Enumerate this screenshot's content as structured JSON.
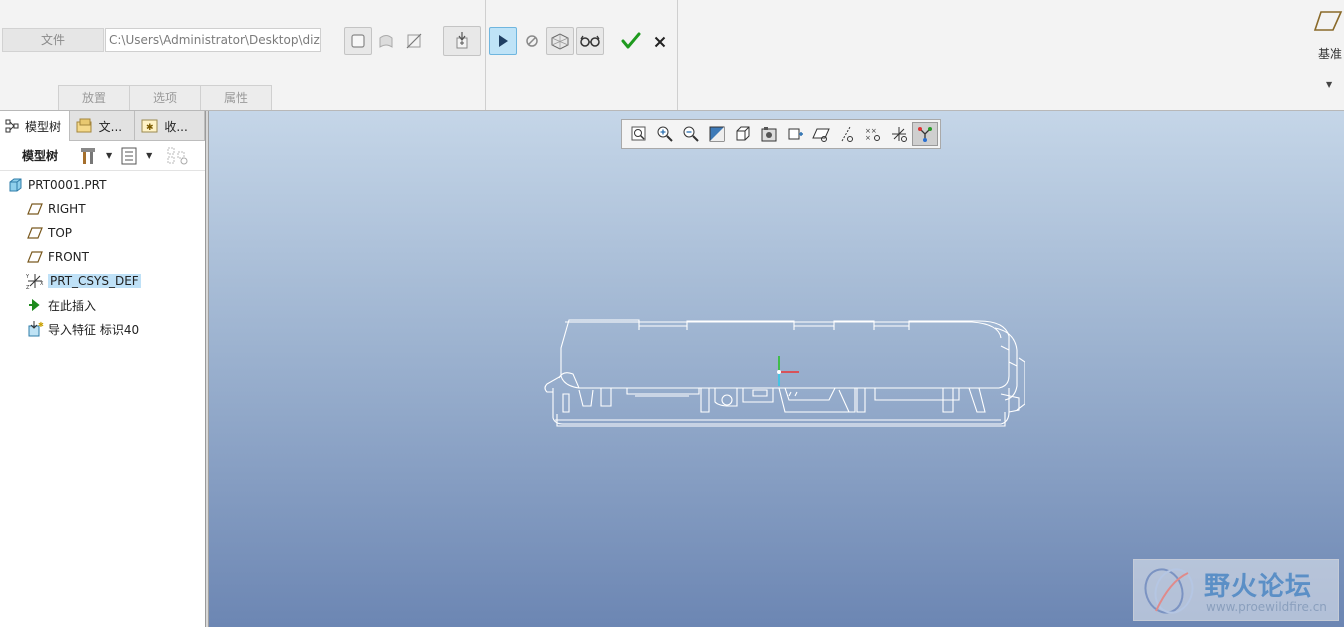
{
  "dashboard": {
    "file_label": "文件",
    "file_path": "C:\\Users\\Administrator\\Desktop\\diz",
    "subtabs": [
      "放置",
      "选项",
      "属性"
    ],
    "datum_label": "基准"
  },
  "panel": {
    "tabs": [
      "模型树",
      "文...",
      "收..."
    ],
    "toolbar_label": "模型树",
    "tree": [
      {
        "label": "PRT0001.PRT",
        "icon": "part-icon"
      },
      {
        "label": "RIGHT",
        "icon": "datum-plane-icon"
      },
      {
        "label": "TOP",
        "icon": "datum-plane-icon"
      },
      {
        "label": "FRONT",
        "icon": "datum-plane-icon"
      },
      {
        "label": "PRT_CSYS_DEF",
        "icon": "coordinate-system-icon",
        "selected": true
      },
      {
        "label": "在此插入",
        "icon": "insert-here-arrow-icon"
      },
      {
        "label": "导入特征 标识40",
        "icon": "import-feature-icon"
      }
    ]
  },
  "watermark": {
    "title": "野火论坛",
    "url": "www.proewildfire.cn"
  },
  "colors": {
    "accent": "#6fb6df",
    "ok_green": "#1e9a1e",
    "selection": "#bfe1f7",
    "bg_top": "#c5d6e8",
    "bg_bottom": "#6c86b3"
  }
}
